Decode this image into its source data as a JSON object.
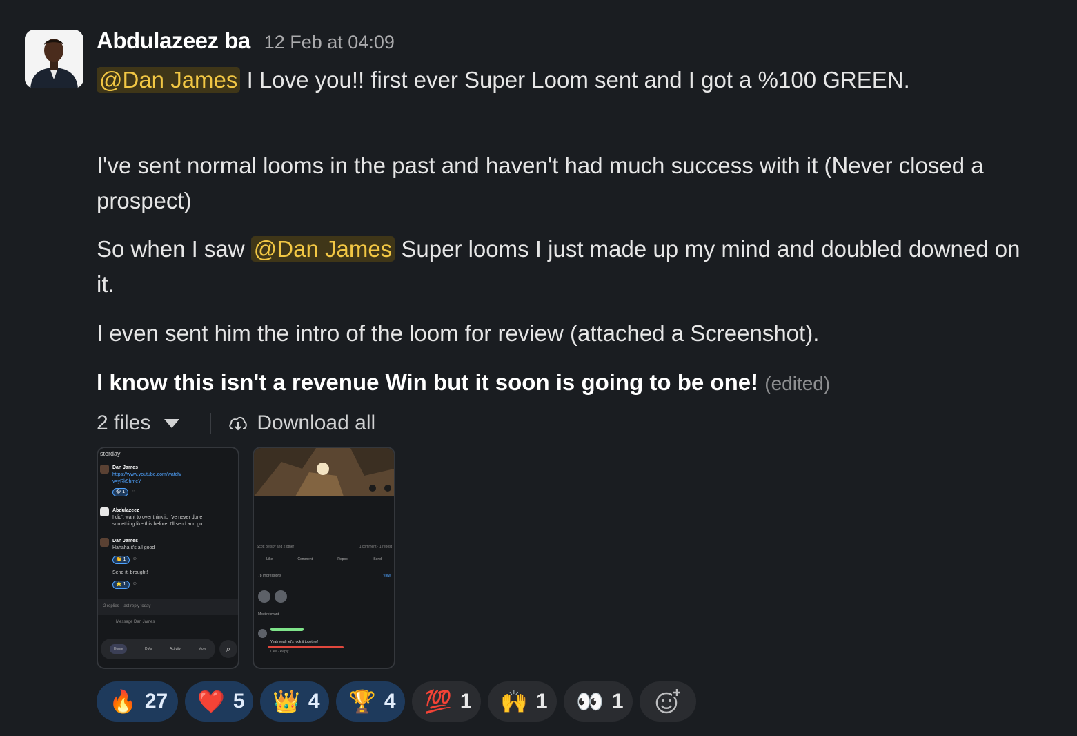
{
  "message": {
    "sender": "Abdulazeez ba",
    "timestamp": "12 Feb at 04:09",
    "line1_mention": "@Dan James",
    "line1_text": "I Love you!! first ever Super Loom sent and I got a %100  GREEN.",
    "para2_line1": "I've sent normal looms in the past and haven't had much success with it (Never closed a",
    "para2_line2": "prospect)",
    "para3_prefix": "So when I saw",
    "para3_mention": "@Dan James",
    "para3_line1_suffix": "Super looms I just made up my mind and doubled downed on",
    "para3_line2": "it.",
    "para4": "I even sent him the intro of the loom for review (attached a Screenshot).",
    "para5_bold": "I know this isn't a revenue Win but it soon is going to be one!",
    "edited": "(edited)"
  },
  "files": {
    "count_label": "2 files",
    "download_label": "Download all"
  },
  "thumb1": {
    "top_label": "sterday",
    "rows": [
      {
        "name": "Dan James",
        "text": "https://www.youtube.com/watch/",
        "text2": "v=yRk9hmeY",
        "reaction": "1"
      },
      {
        "name": "Abdulazeez",
        "text": "I did't want to over think it. I've never done",
        "text2": "something like this before. I'll send and go",
        "reaction": ""
      },
      {
        "name": "Dan James",
        "text": "Hahaha it's all good",
        "text2": "",
        "reaction": "1"
      }
    ],
    "extra_text": "Send it, brought!",
    "extra_reaction": "1",
    "thread_text": "2 replies - last reply today",
    "composer": "Message Dan James",
    "nav": [
      "Home",
      "DMs",
      "Activity",
      "More"
    ]
  },
  "thumb2": {
    "stats_left": "Scott Belsky and 2 other",
    "stats_right": "1 comment · 1 repost",
    "actions": [
      "Like",
      "Comment",
      "Repost",
      "Send"
    ],
    "impressions": "78 impressions",
    "view": "View",
    "most_relevant": "Most relevant",
    "comment_text": "Yeah yeah let's rock it together!",
    "comment_actions": "Like · Reply"
  },
  "reactions": [
    {
      "emoji": "🔥",
      "count": "27",
      "mine": true,
      "name": "fire"
    },
    {
      "emoji": "❤️",
      "count": "5",
      "mine": true,
      "name": "heart"
    },
    {
      "emoji": "👑",
      "count": "4",
      "mine": true,
      "name": "crown"
    },
    {
      "emoji": "🏆",
      "count": "4",
      "mine": true,
      "name": "custom-trophy"
    },
    {
      "emoji": "💯",
      "count": "1",
      "mine": false,
      "name": "hundred"
    },
    {
      "emoji": "🙌",
      "count": "1",
      "mine": false,
      "name": "raised-hands"
    },
    {
      "emoji": "👀",
      "count": "1",
      "mine": false,
      "name": "eyes"
    }
  ]
}
